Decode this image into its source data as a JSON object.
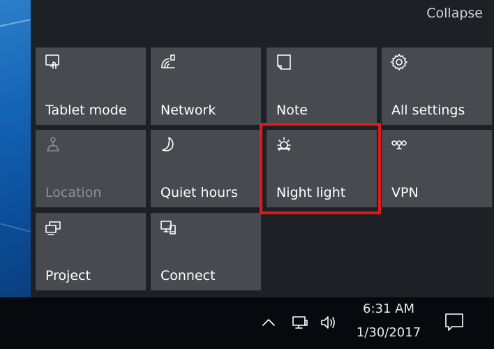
{
  "action_center": {
    "collapse_label": "Collapse",
    "tiles": [
      {
        "label": "Tablet mode",
        "icon": "tablet-mode-icon",
        "enabled": true
      },
      {
        "label": "Network",
        "icon": "network-icon",
        "enabled": true
      },
      {
        "label": "Note",
        "icon": "note-icon",
        "enabled": true
      },
      {
        "label": "All settings",
        "icon": "gear-icon",
        "enabled": true
      },
      {
        "label": "Location",
        "icon": "location-icon",
        "enabled": false
      },
      {
        "label": "Quiet hours",
        "icon": "moon-icon",
        "enabled": true
      },
      {
        "label": "Night light",
        "icon": "sun-icon",
        "enabled": true,
        "highlighted": true
      },
      {
        "label": "VPN",
        "icon": "vpn-icon",
        "enabled": true
      },
      {
        "label": "Project",
        "icon": "project-icon",
        "enabled": true
      },
      {
        "label": "Connect",
        "icon": "connect-icon",
        "enabled": true
      }
    ],
    "highlight_color": "#e3191d",
    "tile_color": "#474a4e",
    "panel_color": "#1d2024"
  },
  "taskbar": {
    "time": "6:31 AM",
    "date": "1/30/2017",
    "tray_icons": [
      "chevron-up-icon",
      "network-icon",
      "volume-icon"
    ],
    "notification_icon": "notification-icon"
  }
}
